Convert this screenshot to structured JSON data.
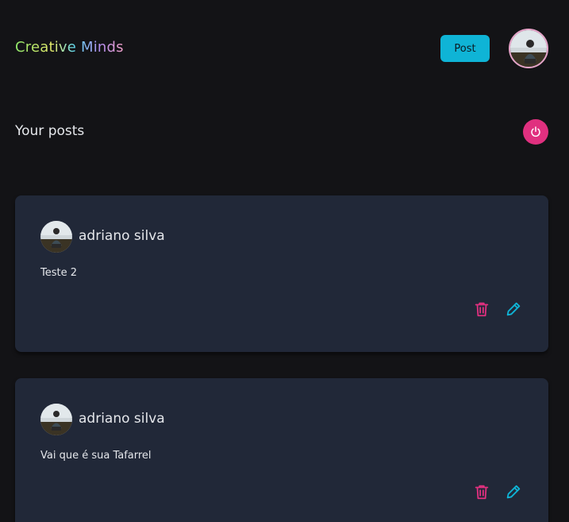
{
  "header": {
    "logo_text": "Creative Minds",
    "post_button_label": "Post"
  },
  "main": {
    "section_title": "Your posts"
  },
  "posts": [
    {
      "author": "adriano silva",
      "content": "Teste 2"
    },
    {
      "author": "adriano silva",
      "content": "Vai que é sua Tafarrel"
    }
  ],
  "colors": {
    "background": "#131316",
    "card": "#212838",
    "accent_cyan": "#0fb4d6",
    "accent_pink": "#e0307f",
    "delete_icon": "#e0307f",
    "edit_icon": "#0fb4d6"
  },
  "icons": {
    "logout": "power-icon",
    "delete": "trash-icon",
    "edit": "pencil-icon"
  }
}
